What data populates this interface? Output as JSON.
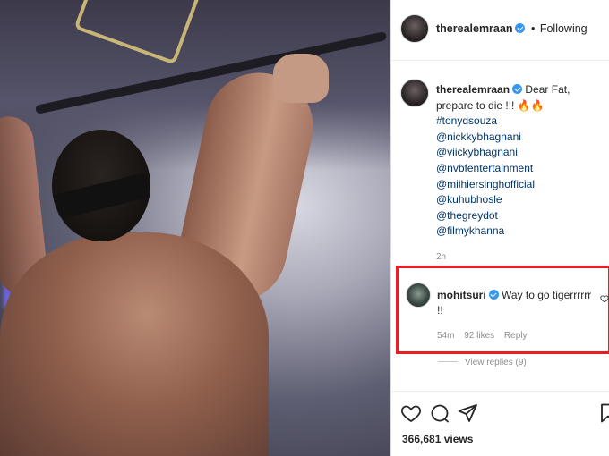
{
  "post": {
    "header": {
      "username": "therealemraan",
      "separator": "•",
      "follow_status": "Following"
    },
    "caption": {
      "username": "therealemraan",
      "text": "Dear Fat, prepare to die !!!",
      "emoji": "🔥🔥",
      "tags": [
        "#tonydsouza",
        "@nickkybhagnani",
        "@viickybhagnani",
        "@nvbfentertainment",
        "@miihiersinghofficial",
        "@kuhubhosle",
        "@thegreydot",
        "@filmykhanna"
      ],
      "time": "2h"
    },
    "comment": {
      "username": "mohitsuri",
      "text": "Way to go tigerrrrrr !!",
      "age": "54m",
      "likes": "92 likes",
      "reply": "Reply",
      "view_replies": "View replies (9)"
    },
    "views": "366,681 views"
  },
  "icons": [
    "verified-badge-icon",
    "heart-icon",
    "comment-icon",
    "share-icon",
    "bookmark-icon"
  ],
  "colors": {
    "highlight_border": "#e61f26",
    "verified": "#3897f0",
    "link": "#003569",
    "muted": "#8e8e8e"
  }
}
